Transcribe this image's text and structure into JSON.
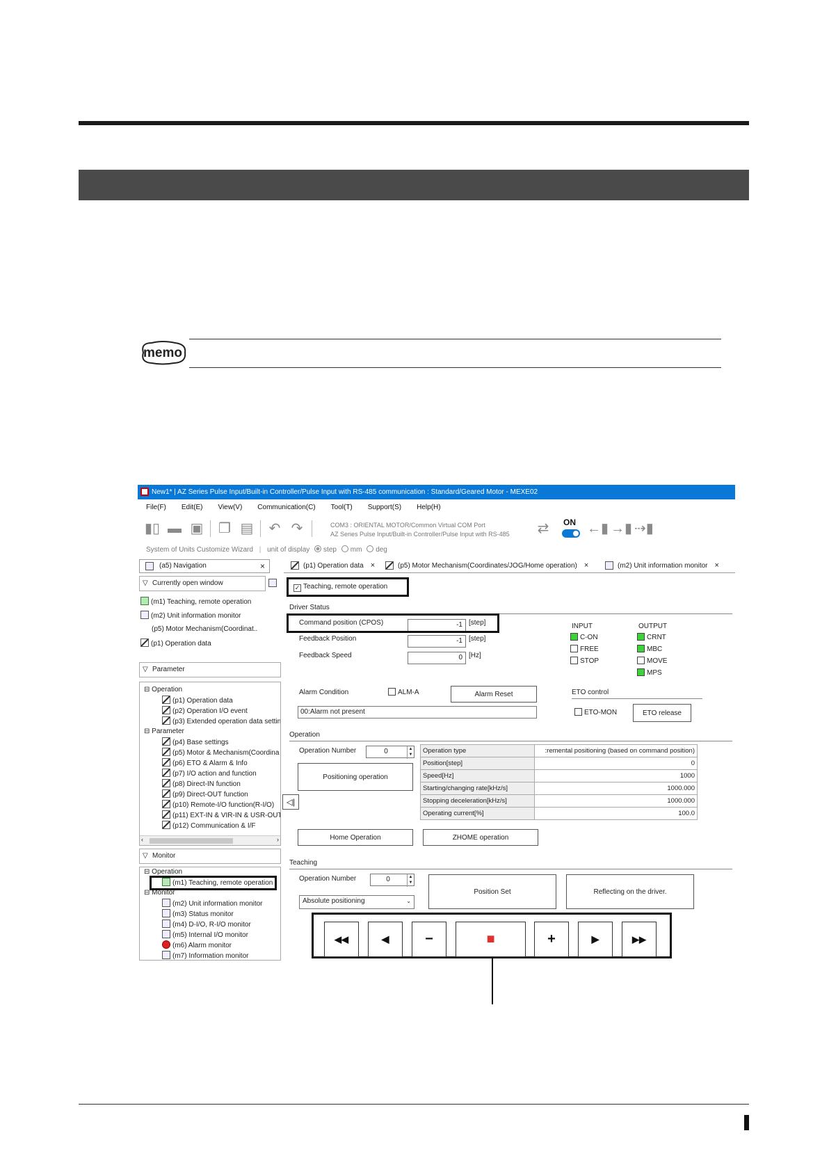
{
  "memo_label": "memo",
  "window": {
    "title": "New1* | AZ Series Pulse Input/Built-in Controller/Pulse Input with RS-485 communication : Standard/Geared Motor - MEXE02"
  },
  "menu": [
    "File(F)",
    "Edit(E)",
    "View(V)",
    "Communication(C)",
    "Tool(T)",
    "Support(S)",
    "Help(H)"
  ],
  "toolbar": {
    "com_line1": "COM3 : ORIENTAL MOTOR/Common Virtual COM Port",
    "com_line2": "AZ Series Pulse Input/Built-in Controller/Pulse Input with RS-485",
    "on_label": "ON"
  },
  "units_bar": {
    "wizard": "System of Units Customize Wizard",
    "unit_label": "unit of display",
    "options": [
      "step",
      "mm",
      "deg"
    ],
    "selected": "step"
  },
  "navigation": {
    "title": "(a5) Navigation",
    "close": "×",
    "open_windows_label": "Currently open window",
    "open_windows": [
      "(m1) Teaching, remote operation",
      "(m2) Unit information monitor",
      "(p5) Motor  Mechanism(Coordinat..",
      "(p1) Operation data"
    ],
    "parameter_label": "Parameter",
    "param_group_operation": "Operation",
    "param_operation_items": [
      "(p1) Operation data",
      "(p2) Operation I/O event",
      "(p3) Extended operation data settin"
    ],
    "param_group_parameter": "Parameter",
    "param_parameter_items": [
      "(p4) Base settings",
      "(p5) Motor & Mechanism(Coordina",
      "(p6) ETO & Alarm & Info",
      "(p7) I/O action and function",
      "(p8) Direct-IN function",
      "(p9) Direct-OUT function",
      "(p10) Remote-I/O function(R-I/O)",
      "(p11) EXT-IN & VIR-IN & USR-OUT",
      "(p12) Communication & I/F"
    ],
    "monitor_label": "Monitor",
    "mon_group_operation": "Operation",
    "mon_operation_items": [
      "(m1) Teaching, remote operation"
    ],
    "mon_group_monitor": "Monitor",
    "mon_monitor_items": [
      "(m2) Unit information monitor",
      "(m3) Status monitor",
      "(m4) D-I/O, R-I/O monitor",
      "(m5) Internal I/O monitor",
      "(m6) Alarm monitor",
      "(m7) Information monitor"
    ]
  },
  "tabs": [
    {
      "label": "(p1) Operation data",
      "close": "×"
    },
    {
      "label": "(p5) Motor  Mechanism(Coordinates/JOG/Home operation)",
      "close": "×"
    },
    {
      "label": "(m2) Unit information monitor",
      "close": "×"
    }
  ],
  "teaching_checkbox": "Teaching, remote operation",
  "driver_status": {
    "title": "Driver Status",
    "command_position": {
      "label": "Command position (CPOS)",
      "value": "-1",
      "unit": "[step]"
    },
    "feedback_position": {
      "label": "Feedback Position",
      "value": "-1",
      "unit": "[step]"
    },
    "feedback_speed": {
      "label": "Feedback Speed",
      "value": "0",
      "unit": "[Hz]"
    },
    "input_title": "INPUT",
    "inputs": [
      {
        "name": "C-ON",
        "on": true
      },
      {
        "name": "FREE",
        "on": false
      },
      {
        "name": "STOP",
        "on": false
      }
    ],
    "output_title": "OUTPUT",
    "outputs": [
      {
        "name": "CRNT",
        "on": true
      },
      {
        "name": "MBC",
        "on": true
      },
      {
        "name": "MOVE",
        "on": false
      },
      {
        "name": "MPS",
        "on": true
      }
    ],
    "alarm_condition_label": "Alarm Condition",
    "alm_a": "ALM-A",
    "alarm_reset": "Alarm Reset",
    "alarm_text": "00:Alarm not present",
    "eto_title": "ETO control",
    "eto_mon": "ETO-MON",
    "eto_release": "ETO release"
  },
  "operation": {
    "title": "Operation",
    "number_label": "Operation Number",
    "number_value": "0",
    "positioning_button": "Positioning operation",
    "home_button": "Home Operation",
    "zhome_button": "ZHOME operation",
    "table": [
      {
        "key": "Operation type",
        "value": ":remental positioning (based on command position)"
      },
      {
        "key": "Position[step]",
        "value": "0"
      },
      {
        "key": "Speed[Hz]",
        "value": "1000"
      },
      {
        "key": "Starting/changing rate[kHz/s]",
        "value": "1000.000"
      },
      {
        "key": "Stopping deceleration[kHz/s]",
        "value": "1000.000"
      },
      {
        "key": "Operating current[%]",
        "value": "100.0"
      }
    ]
  },
  "teaching": {
    "title": "Teaching",
    "number_label": "Operation Number",
    "number_value": "0",
    "mode": "Absolute positioning",
    "position_set": "Position Set",
    "reflect": "Reflecting on the driver.",
    "jog_buttons": [
      "◀◀",
      "◀",
      "−",
      "■",
      "+",
      "▶",
      "▶▶"
    ]
  },
  "collapse_arrow": "◁|",
  "colors": {
    "titlebar": "#0a78d7",
    "led_on": "#3ad43a",
    "stop": "#e03030"
  }
}
